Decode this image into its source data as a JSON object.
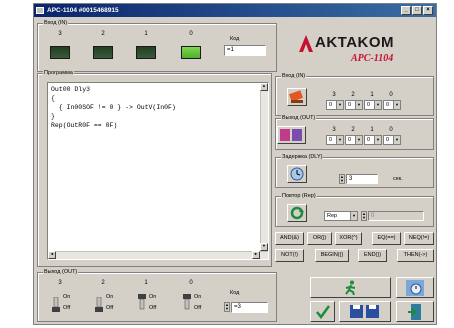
{
  "window": {
    "title": "APC-1104 #0015468915",
    "min": "_",
    "max": "□",
    "close": "×"
  },
  "input_top": {
    "label": "Вход (IN)",
    "bits": [
      "3",
      "2",
      "1",
      "0"
    ],
    "code_label": "Код",
    "code_value": "=1"
  },
  "logo": {
    "name": "AKTAKOM",
    "model": "APC-1104"
  },
  "program": {
    "label": "Программа",
    "lines": [
      "Out00 Dly3",
      "{",
      "  { In00SOF != 0 } -> OutV(In0F)",
      "}",
      "Rep(OutR0F == 0F)"
    ]
  },
  "in_panel": {
    "label": "Вход (IN)",
    "bits": [
      "3",
      "2",
      "1",
      "0"
    ],
    "values": [
      "0",
      "0",
      "0",
      "0"
    ]
  },
  "out_panel": {
    "label": "Выход (OUT)",
    "bits": [
      "3",
      "2",
      "1",
      "0"
    ],
    "values": [
      "0",
      "0",
      "0",
      "0"
    ]
  },
  "delay": {
    "label": "Задержка (DLY)",
    "value": "3",
    "unit": "сек."
  },
  "repeat": {
    "label": "Повтор (Rep)",
    "select": "Rep",
    "value": "0"
  },
  "ops": {
    "row1": [
      "AND(&)",
      "OR(|)",
      "XOR(^)",
      "EQ(==)",
      "NEQ(!=)"
    ],
    "row2": [
      "NOT(!)",
      "BEGIN({)",
      "END(})",
      "THEN(->)"
    ]
  },
  "output_bottom": {
    "label": "Выход (OUT)",
    "bits": [
      "3",
      "2",
      "1",
      "0"
    ],
    "on": "On",
    "off": "Off",
    "code_label": "Код",
    "code_value": "=3"
  }
}
